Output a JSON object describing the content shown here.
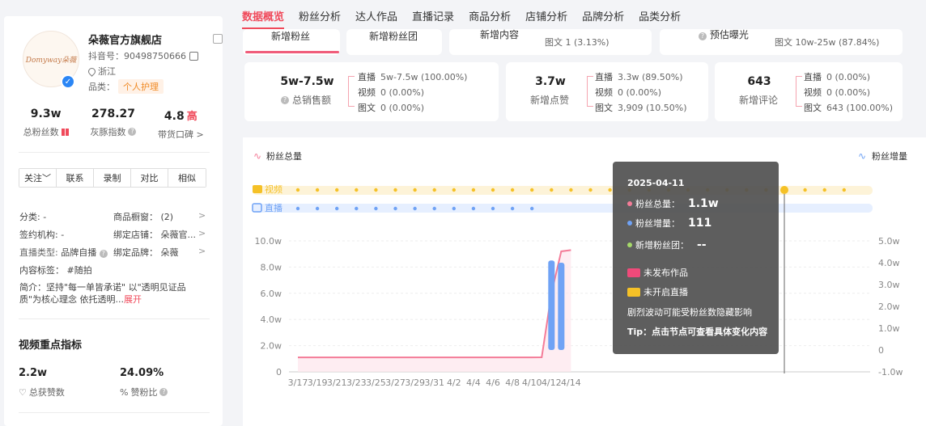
{
  "shop": {
    "logo_text": "Domyway朵薇",
    "name": "朵薇官方旗舰店",
    "douyin_id": "抖音号：90498750666",
    "region": "浙江",
    "category_label": "品类：",
    "category_tag": "个人护理"
  },
  "stats": [
    {
      "value": "9.3w",
      "label": "总粉丝数"
    },
    {
      "value": "278.27",
      "label": "灰豚指数"
    },
    {
      "value": "4.8",
      "badge": "高",
      "label": "带货口碑 >"
    }
  ],
  "actions": [
    "关注﹀",
    "联系",
    "录制",
    "对比",
    "相似"
  ],
  "info": {
    "classification": "分类: -",
    "product_window": "商品橱窗：  (2)",
    "org": "签约机构: -",
    "bound_store": "绑定店铺：  朵薇官...",
    "live_type_k": "直播类型:",
    "live_type_v": "品牌自播",
    "bound_brand": "绑定品牌：  朵薇",
    "content_tags": "内容标签：  #随拍",
    "intro": "简介：坚持\"每一单皆承诺\" 以\"透明见证品质\"为核心理念 依托透明...",
    "intro_more": "展开"
  },
  "video_metrics": {
    "title": "视频重点指标",
    "likes_value": "2.2w",
    "likes_label": "总获赞数",
    "ratio_value": "24.09%",
    "ratio_label": "赞粉比"
  },
  "tabs": [
    "数据概览",
    "粉丝分析",
    "达人作品",
    "直播记录",
    "商品分析",
    "店铺分析",
    "品牌分析",
    "品类分析"
  ],
  "top_cards": {
    "new_fans": "新增粉丝",
    "new_fan_group": "新增粉丝团",
    "new_content": "新增内容",
    "new_content_sub": "图文  1 (3.13%)",
    "est_exposure": "预估曝光",
    "est_exposure_sub": "图文  10w-25w (87.84%)"
  },
  "summary_cards": [
    {
      "value": "5w-7.5w",
      "label": "总销售额",
      "has_q": true,
      "rows": [
        [
          "直播",
          "5w-7.5w (100.00%)"
        ],
        [
          "视频",
          "0 (0.00%)"
        ],
        [
          "图文",
          "0 (0.00%)"
        ]
      ]
    },
    {
      "value": "3.7w",
      "label": "新增点赞",
      "has_q": false,
      "rows": [
        [
          "直播",
          "3.3w (89.50%)"
        ],
        [
          "视频",
          "0 (0.00%)"
        ],
        [
          "图文",
          "3,909 (10.50%)"
        ]
      ]
    },
    {
      "value": "643",
      "label": "新增评论",
      "has_q": false,
      "rows": [
        [
          "直播",
          "0 (0.00%)"
        ],
        [
          "视频",
          "0 (0.00%)"
        ],
        [
          "图文",
          "643 (100.00%)"
        ]
      ]
    }
  ],
  "chart_data": {
    "type": "line",
    "legend_left": "粉丝总量",
    "legend_right": "粉丝增量",
    "track_labels": [
      "视频",
      "直播"
    ],
    "x": [
      "3/17",
      "3/19",
      "3/21",
      "3/23",
      "3/25",
      "3/27",
      "3/29",
      "3/31",
      "4/2",
      "4/4",
      "4/6",
      "4/8",
      "4/10",
      "4/12",
      "4/14"
    ],
    "y_left_ticks": [
      "0",
      "2.0w",
      "4.0w",
      "6.0w",
      "8.0w",
      "10.0w"
    ],
    "y_right_ticks": [
      "-1.0w",
      "0",
      "1.0w",
      "2.0w",
      "3.0w",
      "4.0w",
      "5.0w"
    ],
    "ylim_left": [
      0,
      100000
    ],
    "ylim_right": [
      -10000,
      50000
    ],
    "series": [
      {
        "name": "粉丝总量",
        "axis": "left",
        "points": [
          [
            "3/17",
            11000
          ],
          [
            "4/10",
            11000
          ],
          [
            "4/11",
            11100
          ],
          [
            "4/12",
            60000
          ],
          [
            "4/13",
            92000
          ],
          [
            "4/14",
            93000
          ]
        ]
      },
      {
        "name": "粉丝增量",
        "axis": "right",
        "type": "bar",
        "points": [
          [
            "4/12",
            41000
          ],
          [
            "4/13",
            40000
          ]
        ]
      }
    ],
    "colors": {
      "total": "#f47c98",
      "increase": "#6fa2f5",
      "video": "#f5c127",
      "live": "#6fa2f5"
    }
  },
  "tooltip": {
    "date": "2025-04-11",
    "total_label": "粉丝总量：",
    "total_value": "1.1w",
    "inc_label": "粉丝增量：",
    "inc_value": "111",
    "group_label": "新增粉丝团：",
    "group_value": "--",
    "no_video": "未发布作品",
    "no_live": "未开启直播",
    "warn": "剧烈波动可能受粉丝数隐藏影响",
    "tip": "Tip：点击节点可查看具体变化内容"
  }
}
